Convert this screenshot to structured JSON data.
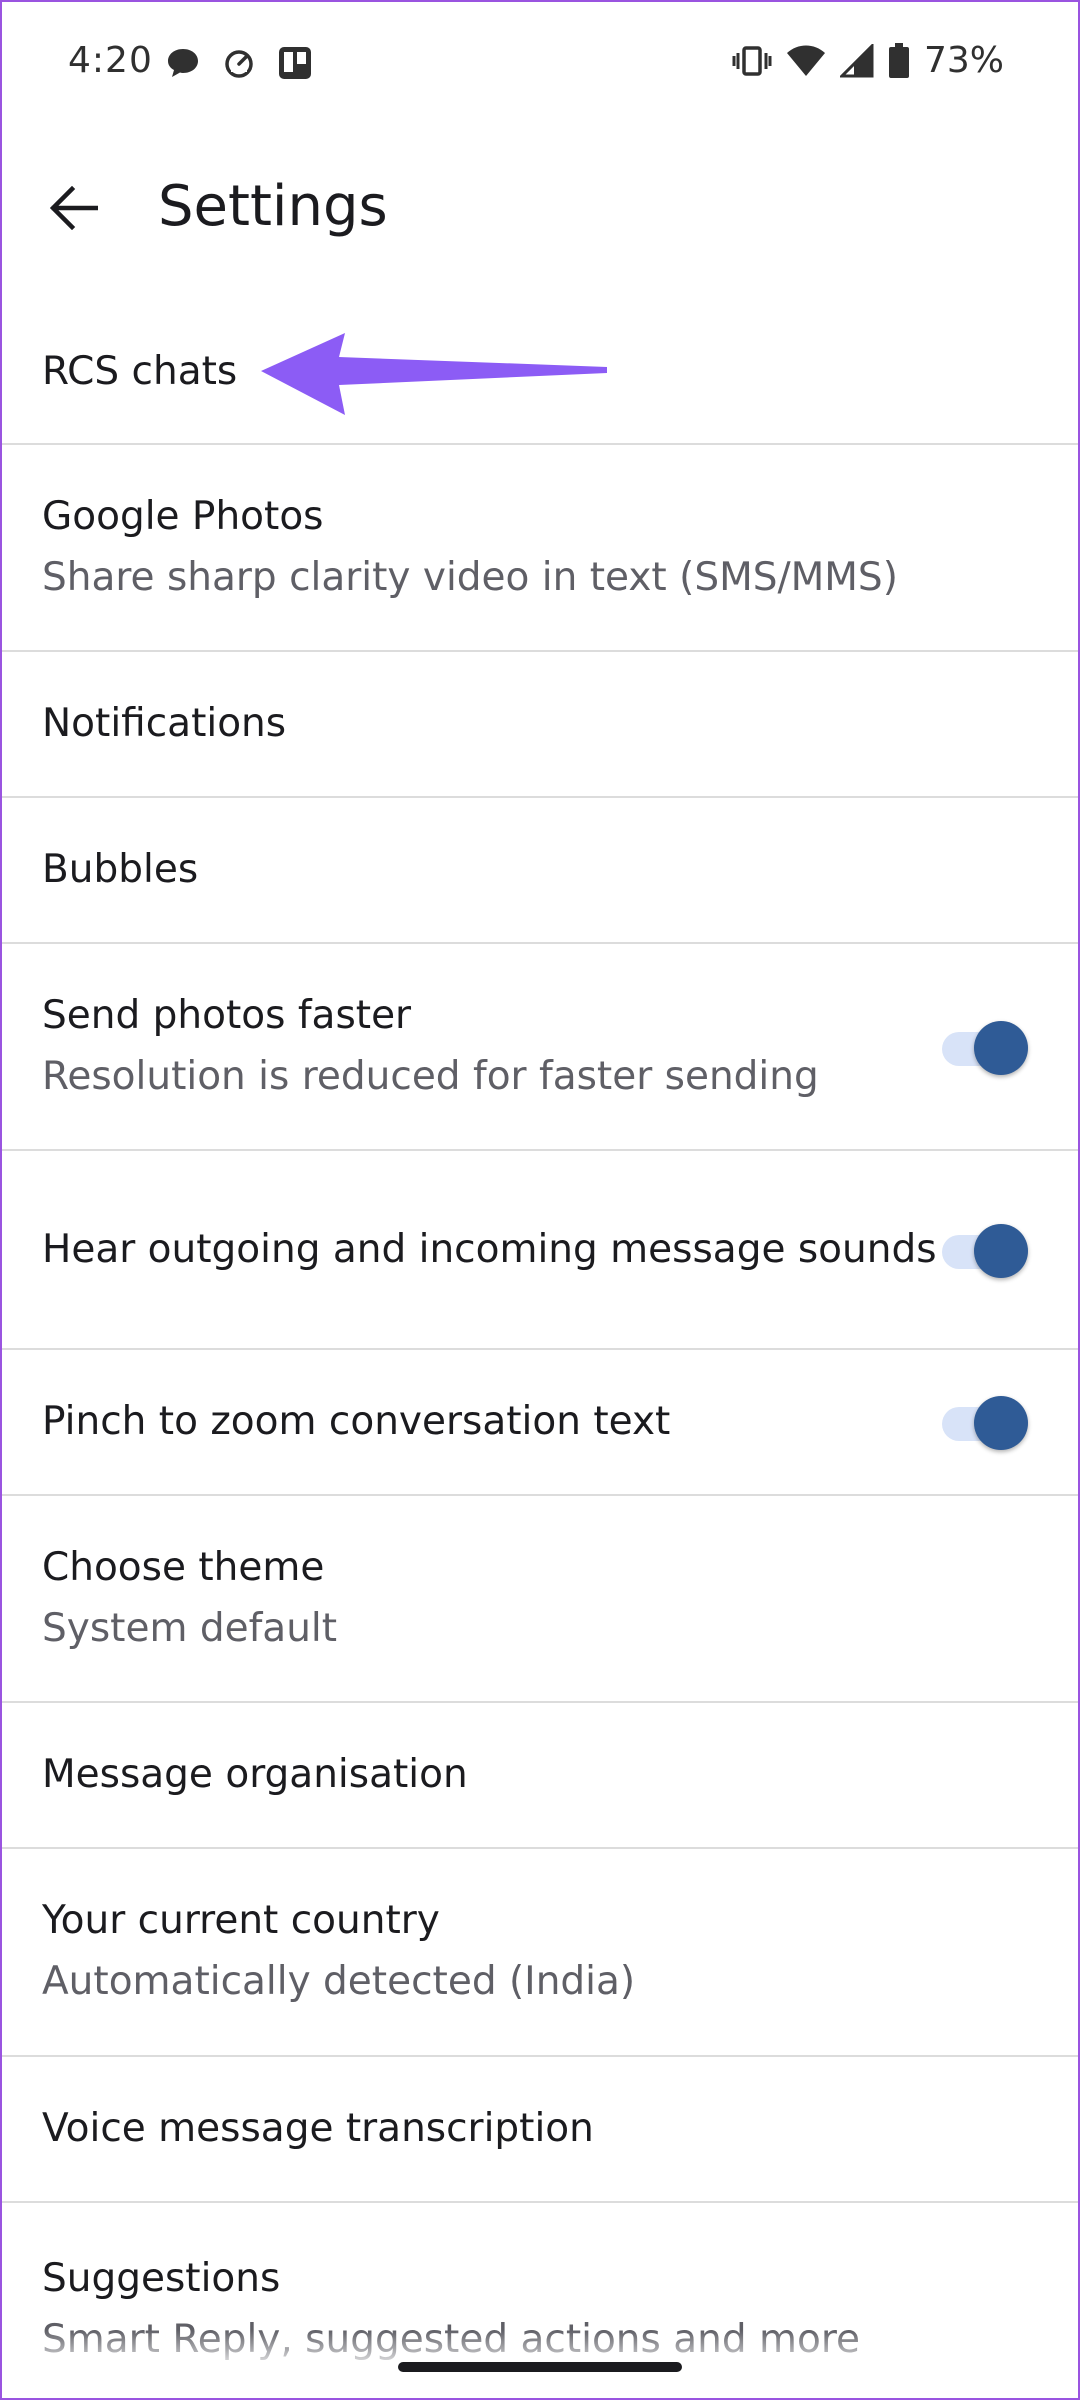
{
  "status_bar": {
    "time": "4:20",
    "battery": "73%",
    "left_icons": [
      "chat-bubble-icon",
      "speedometer-icon",
      "trello-icon"
    ],
    "right_icons": [
      "vibrate-icon",
      "wifi-icon",
      "signal-icon",
      "battery-icon"
    ]
  },
  "app_bar": {
    "title": "Settings",
    "back_icon": "arrow-left-icon"
  },
  "colors": {
    "accent": "#2f5b96",
    "toggle_track": "#d8e3f8",
    "annotation": "#8c5cf5",
    "divider": "#dcdcdc"
  },
  "settings": [
    {
      "title": "RCS chats"
    },
    {
      "title": "Google Photos",
      "subtitle": "Share sharp clarity video in text (SMS/MMS)"
    },
    {
      "title": "Notifications"
    },
    {
      "title": "Bubbles"
    },
    {
      "title": "Send photos faster",
      "subtitle": "Resolution is reduced for faster sending",
      "toggle": true
    },
    {
      "title": "Hear outgoing and incoming message sounds",
      "toggle": true
    },
    {
      "title": "Pinch to zoom conversation text",
      "toggle": true
    },
    {
      "title": "Choose theme",
      "subtitle": "System default"
    },
    {
      "title": "Message organisation"
    },
    {
      "title": "Your current country",
      "subtitle": "Automatically detected (India)"
    },
    {
      "title": "Voice message transcription"
    },
    {
      "title": "Suggestions",
      "subtitle": "Smart Reply, suggested actions and more"
    }
  ]
}
